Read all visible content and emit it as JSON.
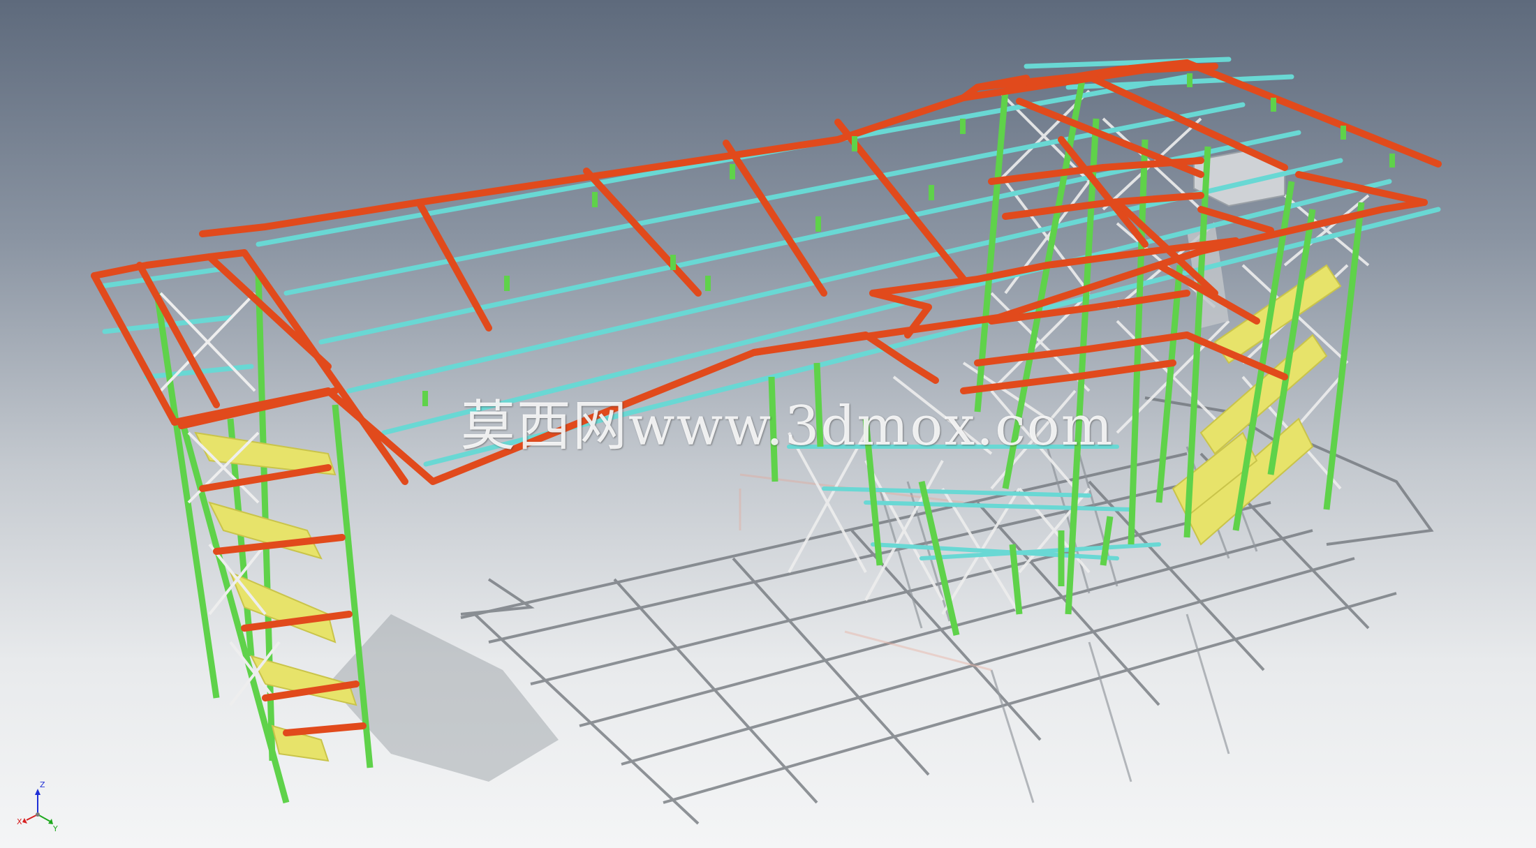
{
  "viewport": {
    "background_top": "#5e6a7c",
    "background_bottom": "#f4f5f6"
  },
  "watermark": {
    "text": "莫西网www.3dmox.com"
  },
  "axis_triad": {
    "x_label": "X",
    "y_label": "Y",
    "z_label": "Z",
    "x_color": "#d62020",
    "y_color": "#1da81d",
    "z_color": "#1f2fd6"
  },
  "model": {
    "beam_color": "#e14a1c",
    "purlin_color": "#69d8d4",
    "column_color": "#5fd24a",
    "brace_color": "#f0f0f0",
    "stair_color": "#e7e36a",
    "shadow_color": "#6d7278"
  }
}
